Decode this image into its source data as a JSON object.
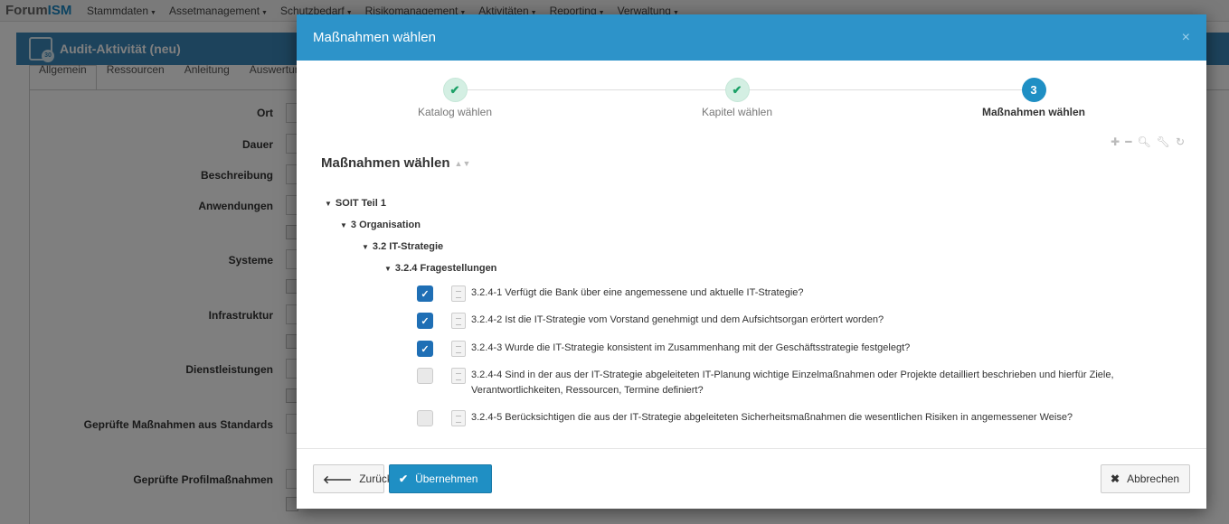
{
  "app": {
    "brand_part1": "Forum",
    "brand_part2": "ISM",
    "nav": [
      "Stammdaten",
      "Assetmanagement",
      "Schutzbedarf",
      "Risikomanagement",
      "Aktivitäten",
      "Reporting",
      "Verwaltung"
    ],
    "panel_title": "Audit-Aktivität (neu)",
    "panel_icon_text": "30",
    "tabs": [
      "Allgemein",
      "Ressourcen",
      "Anleitung",
      "Auswertun"
    ],
    "form_labels": [
      "Ort",
      "Dauer",
      "Beschreibung",
      "Anwendungen",
      "Systeme",
      "Infrastruktur",
      "Dienstleistungen",
      "Geprüfte Maßnahmen aus Standards",
      "Geprüfte Profilmaßnahmen"
    ]
  },
  "modal": {
    "title": "Maßnahmen wählen",
    "close_icon": "×",
    "steps": [
      {
        "label": "Katalog wählen",
        "state": "done",
        "marker": "✔"
      },
      {
        "label": "Kapitel wählen",
        "state": "done",
        "marker": "✔"
      },
      {
        "label": "Maßnahmen wählen",
        "state": "active",
        "marker": "3"
      }
    ],
    "toolbar_icons": [
      "plus-icon",
      "minus-icon",
      "search-icon",
      "wrench-icon",
      "refresh-icon"
    ],
    "tree_title": "Maßnahmen wählen",
    "tree": {
      "level1": "SOIT Teil 1",
      "level2": "3 Organisation",
      "level3": "3.2 IT-Strategie",
      "level4": "3.2.4 Fragestellungen",
      "items": [
        {
          "text": "3.2.4-1 Verfügt die Bank über eine angemessene und aktuelle IT-Strategie?",
          "checked": true
        },
        {
          "text": "3.2.4-2 Ist die IT-Strategie vom Vorstand genehmigt und dem Aufsichtsorgan erörtert worden?",
          "checked": true
        },
        {
          "text": "3.2.4-3 Wurde die IT-Strategie konsistent im Zusammenhang mit der Geschäftsstrategie festgelegt?",
          "checked": true
        },
        {
          "text": "3.2.4-4 Sind in der aus der IT-Strategie abgeleiteten IT-Planung wichtige Einzelmaßnahmen oder Projekte detailliert beschrieben und hierfür Ziele, Verantwortlichkeiten, Ressourcen, Termine definiert?",
          "checked": false
        },
        {
          "text": "3.2.4-5 Berücksichtigen die aus der IT-Strategie abgeleiteten Sicherheitsmaßnahmen die wesentlichen Risiken in angemessener Weise?",
          "checked": false
        }
      ]
    },
    "buttons": {
      "back": "Zurück",
      "apply": "Übernehmen",
      "cancel": "Abbrechen"
    },
    "colors": {
      "accent": "#2d93c9",
      "checked": "#1f6fb5",
      "done": "#1da168"
    }
  }
}
